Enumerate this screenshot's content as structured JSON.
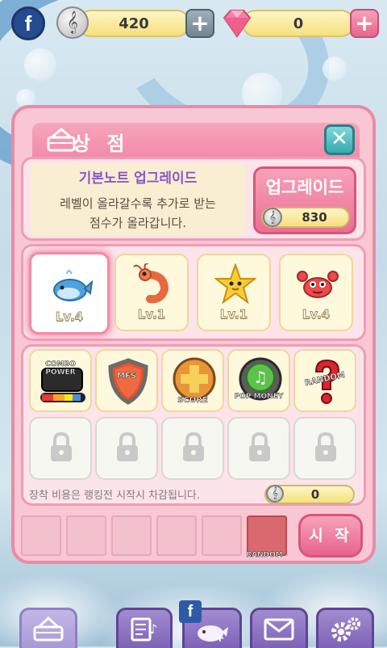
{
  "topbar": {
    "facebook_glyph": "f",
    "coins": "420",
    "coin_icon": "treble-clef-coin-icon",
    "gems": "0",
    "gem_icon": "pink-diamond-icon"
  },
  "shop": {
    "title": "상 점",
    "upgrade_title": "기본노트 업그레이드",
    "upgrade_desc_line1": "레벨이 올라갈수록 추가로 받는",
    "upgrade_desc_line2": "점수가 올라갑니다.",
    "upgrade_button": "업그레이드",
    "upgrade_cost": "830"
  },
  "characters": [
    {
      "name": "whale",
      "level": "Lv.4",
      "selected": true
    },
    {
      "name": "shrimp",
      "level": "Lv.1",
      "selected": false
    },
    {
      "name": "starfish",
      "level": "Lv.1",
      "selected": false
    },
    {
      "name": "crab",
      "level": "Lv.4",
      "selected": false
    }
  ],
  "items": [
    {
      "name": "combo-power",
      "label": "COMBO POWER"
    },
    {
      "name": "mfs-shield",
      "label": "MFS"
    },
    {
      "name": "score-plus",
      "label": "SCORE"
    },
    {
      "name": "pop-money",
      "label": "POP MONEY"
    },
    {
      "name": "random",
      "label": "RANDOM"
    }
  ],
  "equip_notice": "장착 비용은 랭킹전 시작시 차감됩니다.",
  "equip_cost": "0",
  "slots": {
    "random_label": "RANDOM"
  },
  "start_button": "시 작",
  "nav": {
    "facebook_glyph": "f"
  },
  "colors": {
    "panel_pink": "#f8c7d3",
    "accent_pink": "#f28aa8",
    "nav_purple": "#7e63b6",
    "close_teal": "#3aa9b2"
  }
}
